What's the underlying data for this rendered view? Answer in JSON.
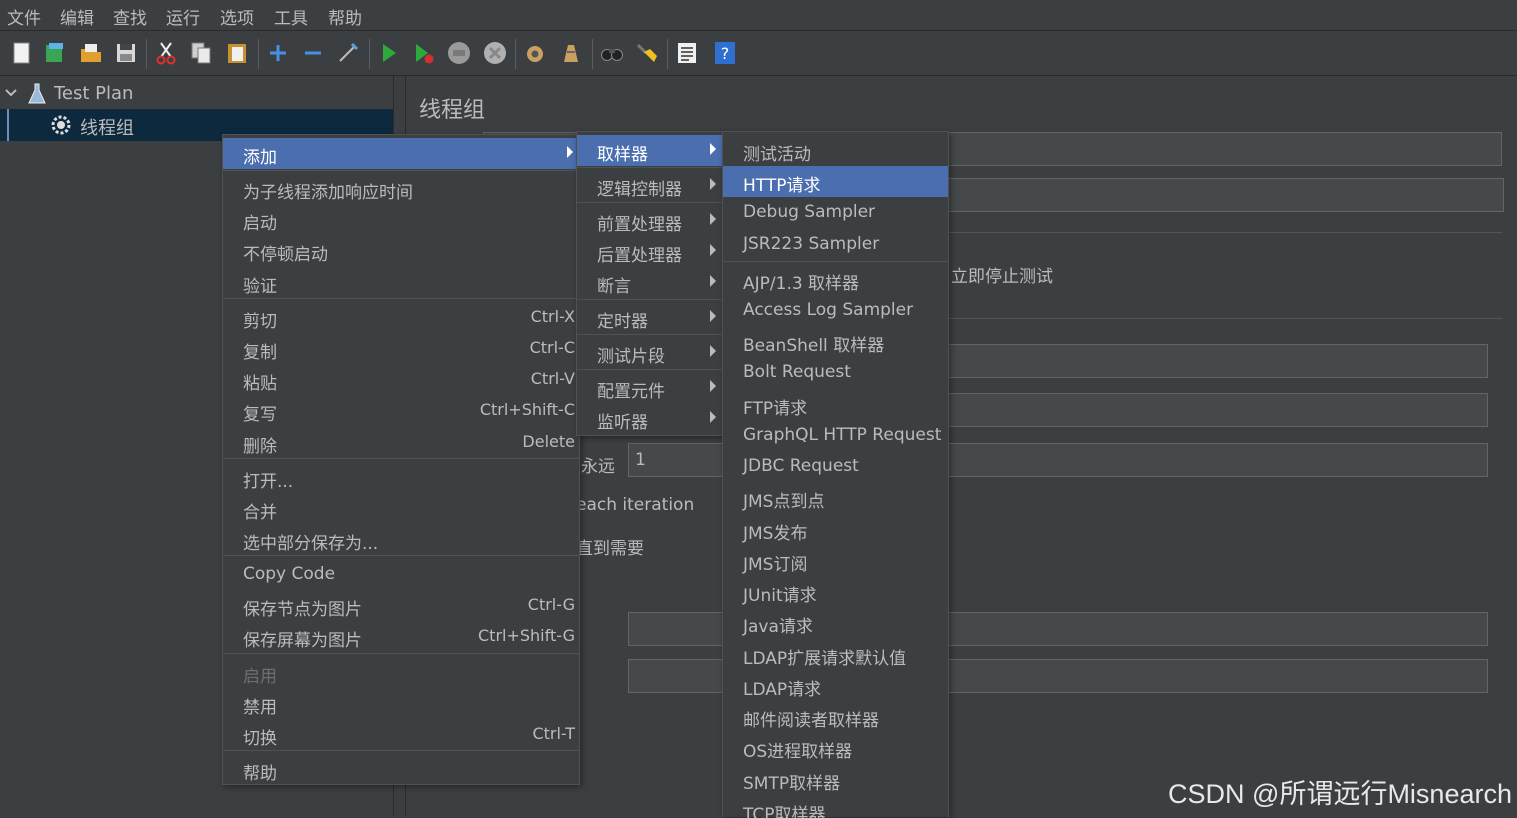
{
  "menubar": {
    "items": [
      "文件",
      "编辑",
      "查找",
      "运行",
      "选项",
      "工具",
      "帮助"
    ]
  },
  "toolbar": {
    "buttons": [
      "new-icon",
      "templates-icon",
      "open-icon",
      "save-icon",
      "cut-icon",
      "copy-icon",
      "paste-icon",
      "expand-icon",
      "collapse-icon",
      "toggle-icon",
      "start-icon",
      "start-no-pause-icon",
      "stop-icon",
      "shutdown-icon",
      "clear-icon",
      "clear-all-icon",
      "search-icon",
      "reset-search-icon",
      "function-helper-icon",
      "help-icon"
    ]
  },
  "tree": {
    "root": "Test Plan",
    "child": "线程组"
  },
  "panel": {
    "title": "线程组",
    "stop_now": "立即停止测试",
    "forever": "永远",
    "loop_value": "1",
    "each_iteration": "each iteration",
    "until_needed": "直到需要"
  },
  "context_menu": {
    "add": "添加",
    "add_think_times": "为子线程添加响应时间",
    "start": "启动",
    "start_no_pause": "不停顿启动",
    "validate": "验证",
    "cut": "剪切",
    "cut_key": "Ctrl-X",
    "copy": "复制",
    "copy_key": "Ctrl-C",
    "paste": "粘贴",
    "paste_key": "Ctrl-V",
    "duplicate": "复写",
    "duplicate_key": "Ctrl+Shift-C",
    "delete": "删除",
    "delete_key": "Delete",
    "open": "打开...",
    "merge": "合并",
    "save_selection": "选中部分保存为...",
    "copy_code": "Copy Code",
    "save_node_image": "保存节点为图片",
    "save_node_image_key": "Ctrl-G",
    "save_screen_image": "保存屏幕为图片",
    "save_screen_image_key": "Ctrl+Shift-G",
    "enable": "启用",
    "disable": "禁用",
    "toggle": "切换",
    "toggle_key": "Ctrl-T",
    "help": "帮助"
  },
  "add_submenu": {
    "sampler": "取样器",
    "logic_controller": "逻辑控制器",
    "pre_processor": "前置处理器",
    "post_processor": "后置处理器",
    "assertion": "断言",
    "timer": "定时器",
    "test_fragment": "测试片段",
    "config_element": "配置元件",
    "listener": "监听器"
  },
  "sampler_submenu": {
    "group1": [
      "测试活动",
      "HTTP请求",
      "Debug Sampler",
      "JSR223 Sampler"
    ],
    "group2": [
      "AJP/1.3 取样器",
      "Access Log Sampler",
      "BeanShell 取样器",
      "Bolt Request",
      "FTP请求",
      "GraphQL HTTP Request",
      "JDBC Request",
      "JMS点到点",
      "JMS发布",
      "JMS订阅",
      "JUnit请求",
      "Java请求",
      "LDAP扩展请求默认值",
      "LDAP请求",
      "邮件阅读者取样器",
      "OS进程取样器",
      "SMTP取样器",
      "TCP取样器"
    ]
  },
  "watermark": "CSDN @所谓远行Misnearch"
}
